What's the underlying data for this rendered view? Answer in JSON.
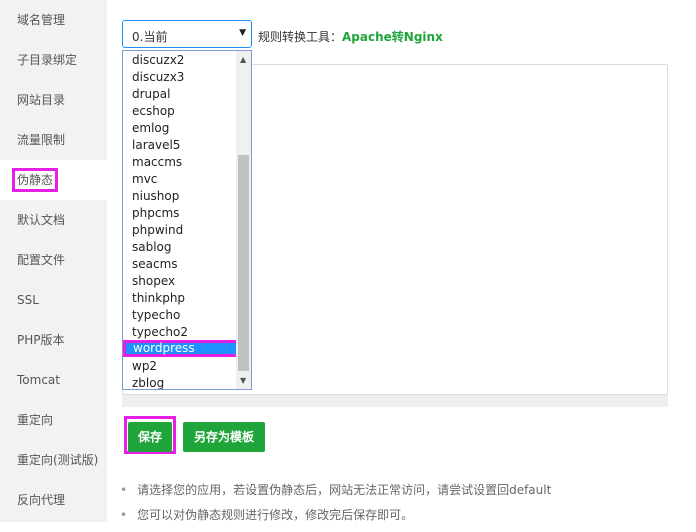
{
  "sidebar": {
    "items": [
      {
        "label": "域名管理"
      },
      {
        "label": "子目录绑定"
      },
      {
        "label": "网站目录"
      },
      {
        "label": "流量限制"
      },
      {
        "label": "伪静态"
      },
      {
        "label": "默认文档"
      },
      {
        "label": "配置文件"
      },
      {
        "label": "SSL"
      },
      {
        "label": "PHP版本"
      },
      {
        "label": "Tomcat"
      },
      {
        "label": "重定向"
      },
      {
        "label": "重定向(测试版)"
      },
      {
        "label": "反向代理"
      }
    ],
    "active": "伪静态"
  },
  "rewrite": {
    "select_value": "0.当前",
    "rule_tool_label": "规则转换工具：",
    "rule_tool_link": "Apache转Nginx",
    "options": [
      "discuzx2",
      "discuzx3",
      "drupal",
      "ecshop",
      "emlog",
      "laravel5",
      "maccms",
      "mvc",
      "niushop",
      "phpcms",
      "phpwind",
      "sablog",
      "seacms",
      "shopex",
      "thinkphp",
      "typecho",
      "typecho2",
      "wordpress",
      "wp2",
      "zblog"
    ],
    "highlighted_option": "wordpress"
  },
  "buttons": {
    "save": "保存",
    "save_as_template": "另存为模板"
  },
  "tips": [
    "请选择您的应用，若设置伪静态后，网站无法正常访问，请尝试设置回default",
    "您可以对伪静态规则进行修改，修改完后保存即可。"
  ],
  "colors": {
    "accent": "#20a53a",
    "highlight": "#1e90ff",
    "annotation": "#e61ee6"
  }
}
